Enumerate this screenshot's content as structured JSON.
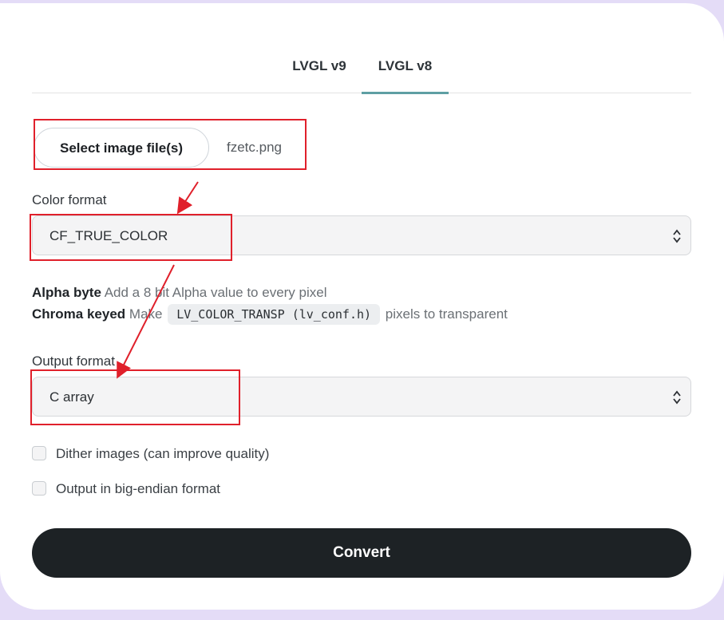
{
  "tabs": [
    {
      "label": "LVGL v9",
      "active": false
    },
    {
      "label": "LVGL v8",
      "active": true
    }
  ],
  "file": {
    "button_label": "Select image file(s)",
    "file_name": "fzetc.png"
  },
  "color_format": {
    "label": "Color format",
    "value": "CF_TRUE_COLOR"
  },
  "descriptions": {
    "alpha_title": "Alpha byte",
    "alpha_text": "Add a 8 bit Alpha value to every pixel",
    "chroma_title": "Chroma keyed",
    "chroma_pre": "Make",
    "chroma_code": "LV_COLOR_TRANSP (lv_conf.h)",
    "chroma_post": "pixels to transparent"
  },
  "output_format": {
    "label": "Output format",
    "value": "C array"
  },
  "options": [
    {
      "label": "Dither images (can improve quality)",
      "checked": false
    },
    {
      "label": "Output in big-endian format",
      "checked": false
    }
  ],
  "convert_label": "Convert",
  "colors": {
    "accent": "#5e9fa3",
    "annotation_red": "#e0202b",
    "button_dark": "#1d2225",
    "background": "#e4dcf7"
  }
}
